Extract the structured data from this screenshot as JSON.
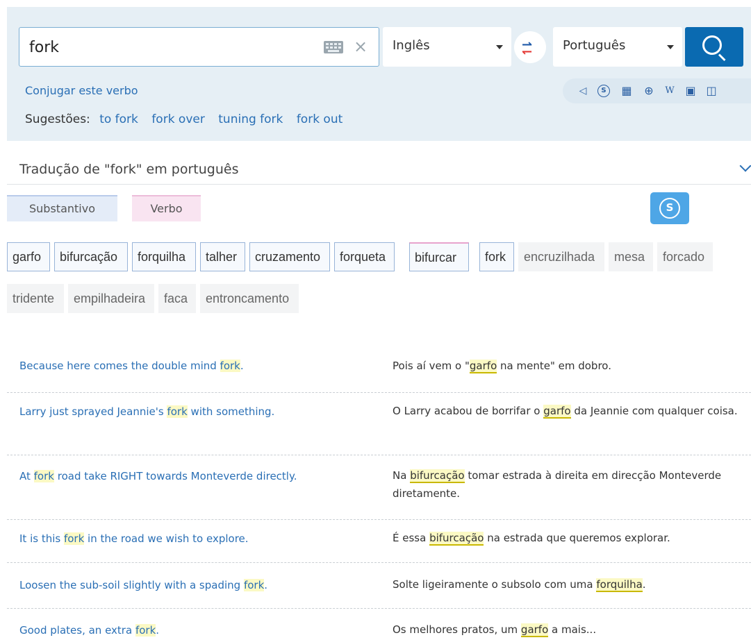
{
  "search": {
    "query": "fork",
    "source_lang": "Inglês",
    "target_lang": "Português"
  },
  "conjugate_label": "Conjugar este verbo",
  "suggestions": {
    "label": "Sugestões:",
    "items": [
      "to fork",
      "fork over",
      "tuning fork",
      "fork out"
    ]
  },
  "tools": [
    "speaker-icon",
    "skype-icon",
    "table-icon",
    "globe-icon",
    "wikipedia-icon",
    "image-icon",
    "book-icon"
  ],
  "translation_title": "Tradução de \"fork\" em português",
  "pos_tabs": {
    "noun": "Substantivo",
    "verb": "Verbo"
  },
  "chips_row1": [
    {
      "text": "garfo",
      "kind": "noun"
    },
    {
      "text": "bifurcação",
      "kind": "noun"
    },
    {
      "text": "forquilha",
      "kind": "noun"
    },
    {
      "text": "talher",
      "kind": "noun"
    },
    {
      "text": "cruzamento",
      "kind": "noun"
    },
    {
      "text": "forqueta",
      "kind": "noun"
    },
    {
      "text": "bifurcar",
      "kind": "verb"
    },
    {
      "text": "fork",
      "kind": "noun"
    },
    {
      "text": "encruzilhada",
      "kind": "plain"
    },
    {
      "text": "mesa",
      "kind": "plain"
    },
    {
      "text": "forcado",
      "kind": "plain"
    }
  ],
  "chips_row2": [
    {
      "text": "tridente",
      "kind": "plain"
    },
    {
      "text": "empilhadeira",
      "kind": "plain"
    },
    {
      "text": "faca",
      "kind": "plain"
    },
    {
      "text": "entroncamento",
      "kind": "plain"
    }
  ],
  "examples": [
    {
      "src": [
        "Because here comes the double mind ",
        "fork",
        "."
      ],
      "tgt": [
        "Pois aí vem o \"",
        "garfo",
        " na mente\" em dobro."
      ]
    },
    {
      "src": [
        "Larry just sprayed Jeannie's ",
        "fork",
        " with something."
      ],
      "tgt": [
        "O Larry acabou de borrifar o ",
        "garfo",
        " da Jeannie com qualquer coisa."
      ]
    },
    {
      "src": [
        "At ",
        "fork",
        " road take RIGHT towards Monteverde directly."
      ],
      "tgt": [
        "Na ",
        "bifurcação",
        " tomar estrada à direita em direcção Monteverde diretamente."
      ]
    },
    {
      "src": [
        "It is this ",
        "fork",
        " in the road we wish to explore."
      ],
      "tgt": [
        "É essa ",
        "bifurcação",
        " na estrada que queremos explorar."
      ]
    },
    {
      "src": [
        "Loosen the sub-soil slightly with a spading ",
        "fork",
        "."
      ],
      "tgt": [
        "Solte ligeiramente o subsolo com uma ",
        "forquilha",
        "."
      ]
    },
    {
      "src": [
        "Good plates, an extra ",
        "fork",
        "."
      ],
      "tgt": [
        "Os melhores pratos, um ",
        "garfo",
        " a mais..."
      ]
    }
  ]
}
